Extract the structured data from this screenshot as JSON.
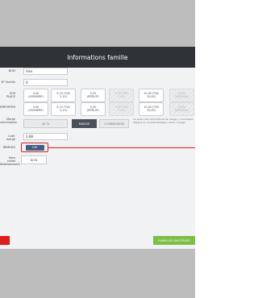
{
  "header": {
    "title": "Informations famille"
  },
  "form": {
    "name": {
      "label": "NOM",
      "value": "Vins"
    },
    "number": {
      "label": "N° famille",
      "value": "0"
    },
    "sur_place": {
      "label": "SUR PLACE",
      "options": [
        {
          "line1": "0,00",
          "line2": "(EXONÉRÉ)",
          "disabled": false
        },
        {
          "line1": "5,10 (TVA",
          "line2": "2,10)",
          "disabled": false
        },
        {
          "line1": "5,50",
          "line2": "(RÉDUIT)",
          "disabled": false
        },
        {
          "line1": "7,00 (TVA",
          "line2": "7,00)",
          "disabled": true
        },
        {
          "line1": "10,00 (TVA",
          "line2": "10,00)",
          "disabled": false
        },
        {
          "line1": "19,60",
          "line2": "(NORMAL)",
          "disabled": true
        }
      ]
    },
    "emporter": {
      "label": "EMPORTER",
      "options": [
        {
          "line1": "0,00",
          "line2": "(EXONÉRÉ)",
          "disabled": false
        },
        {
          "line1": "5,10 (TVA",
          "line2": "2,10)",
          "disabled": false
        },
        {
          "line1": "5,50",
          "line2": "(RÉDUIT)",
          "disabled": false
        },
        {
          "line1": "7,00 (TVA",
          "line2": "7,00)",
          "disabled": true
        },
        {
          "line1": "10,00 (TVA",
          "line2": "10,00)",
          "disabled": false
        },
        {
          "line1": "19,60",
          "line2": "(NORMAL)",
          "disabled": true
        }
      ]
    },
    "marge": {
      "label_line1": "Marge",
      "label_line2": "commission",
      "percent": "40 %",
      "option_marge": "MARGE",
      "option_commission": "COMMISSION",
      "note": "La saisie des informations de marge / commission dépend du module Pilotage / stock / marge"
    },
    "coef": {
      "label": "Coef. marge",
      "value": "1,68"
    },
    "remises": {
      "label": "REMISES",
      "value": "OUI"
    },
    "ticket": {
      "label_line1": "Sans ticket",
      "label_line2": "établissement",
      "value": "NON"
    }
  },
  "footer": {
    "multi_label": "FAMILLES MULTIPLES"
  },
  "colors": {
    "header_bg": "#2f3338",
    "accent_red": "#e11b1b",
    "accent_green": "#7bc043",
    "toggle_on": "#3f5f86"
  }
}
